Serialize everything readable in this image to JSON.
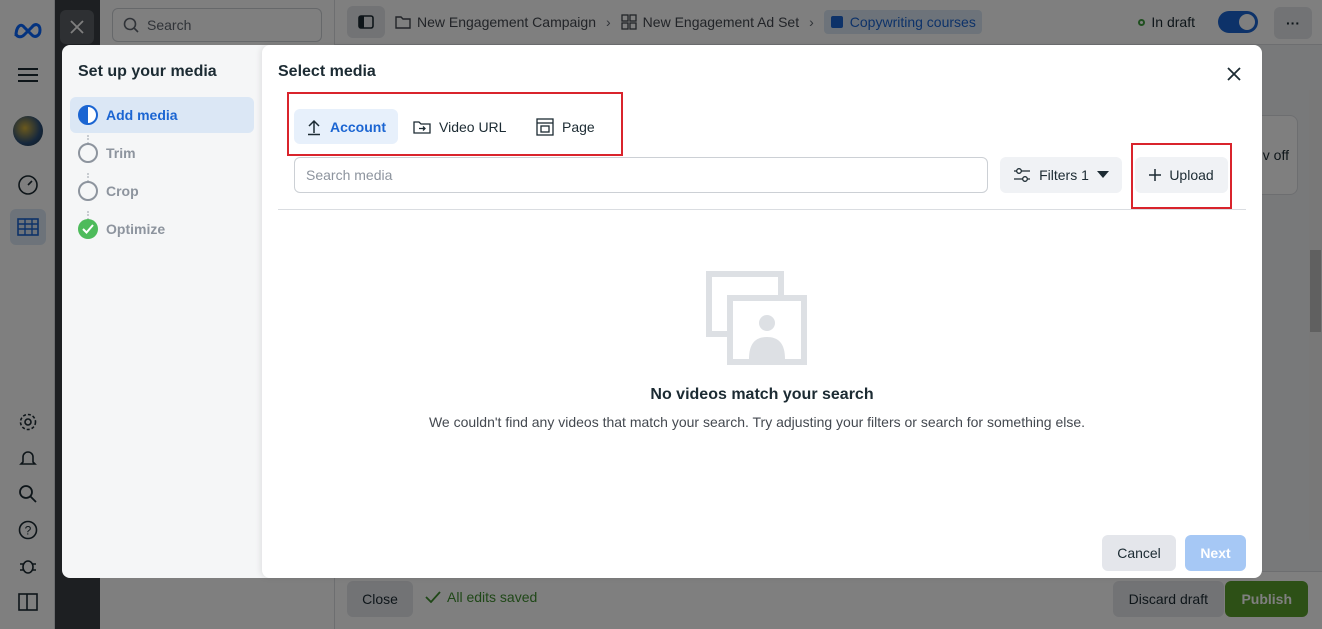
{
  "app": {
    "search_placeholder": "Search",
    "breadcrumbs": [
      {
        "label": "New Engagement Campaign",
        "icon": "folder-icon"
      },
      {
        "label": "New Engagement Ad Set",
        "icon": "grid-icon"
      },
      {
        "label": "Copywriting courses",
        "icon": "ad-icon"
      }
    ],
    "status": "In draft",
    "card_partial_text": "v off",
    "bottom": {
      "close_label": "Close",
      "saved_label": "All edits saved",
      "discard_label": "Discard draft",
      "publish_label": "Publish",
      "publish_color": "#5aa02c"
    },
    "accent_color": "#1b65d2"
  },
  "stepper": {
    "title": "Set up your media",
    "steps": [
      {
        "label": "Add media",
        "state": "active"
      },
      {
        "label": "Trim",
        "state": "pending"
      },
      {
        "label": "Crop",
        "state": "pending"
      },
      {
        "label": "Optimize",
        "state": "done"
      }
    ]
  },
  "modal": {
    "title": "Select media",
    "tabs": [
      {
        "label": "Account",
        "icon": "upload-arrow-icon",
        "active": true
      },
      {
        "label": "Video URL",
        "icon": "folder-arrow-icon",
        "active": false
      },
      {
        "label": "Page",
        "icon": "page-icon",
        "active": false
      }
    ],
    "search_placeholder": "Search media",
    "filters_label": "Filters 1",
    "upload_label": "Upload",
    "empty_title": "No videos match your search",
    "empty_subtitle": "We couldn't find any videos that match your search. Try adjusting your filters or search for something else.",
    "cancel_label": "Cancel",
    "next_label": "Next",
    "highlight_color": "#d9242c"
  }
}
